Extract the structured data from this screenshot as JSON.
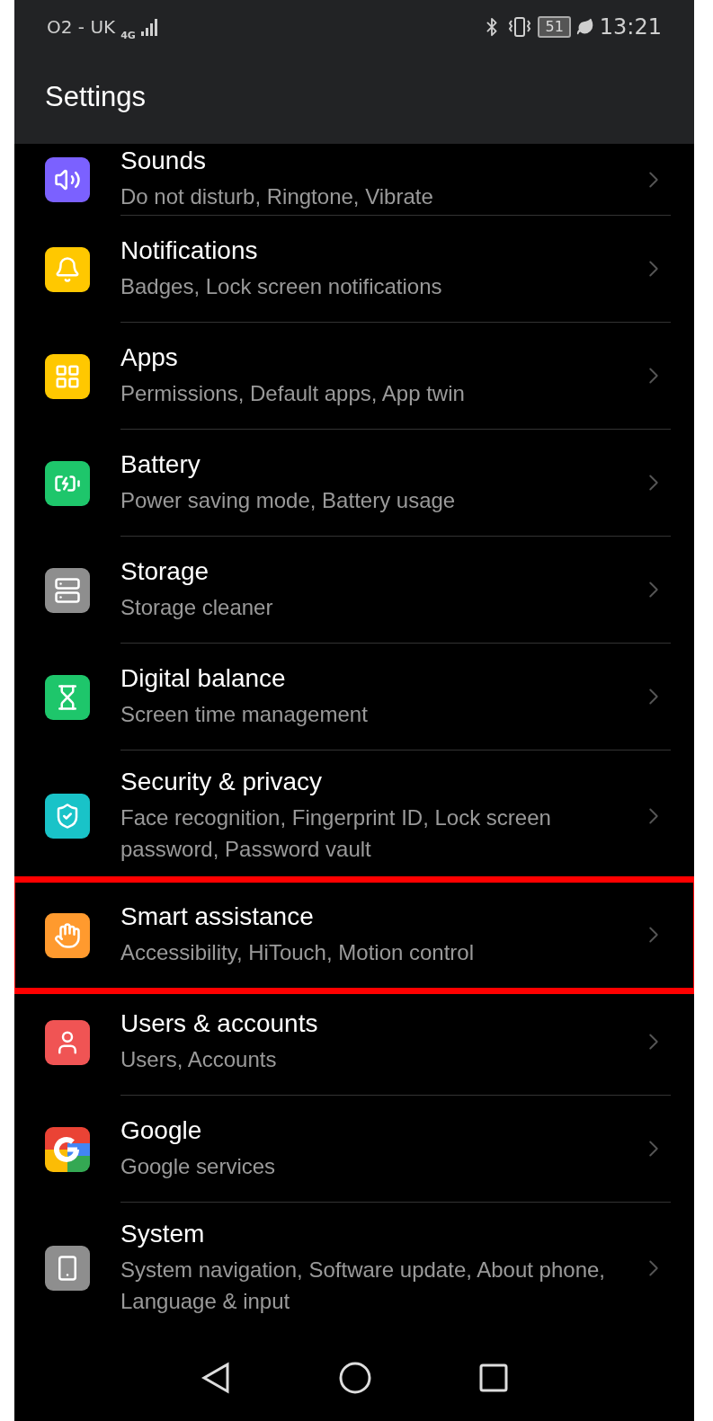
{
  "status_bar": {
    "carrier": "O2 - UK",
    "network": "4G",
    "battery": "51",
    "time": "13:21"
  },
  "title": "Settings",
  "items": [
    {
      "kind": "sound",
      "color": "#7b61ff",
      "title": "Sounds",
      "subtitle": "Do not disturb, Ringtone, Vibrate",
      "highlighted": false
    },
    {
      "kind": "bell",
      "color": "#ffc800",
      "title": "Notifications",
      "subtitle": "Badges, Lock screen notifications",
      "highlighted": false
    },
    {
      "kind": "grid",
      "color": "#ffc800",
      "title": "Apps",
      "subtitle": "Permissions, Default apps, App twin",
      "highlighted": false
    },
    {
      "kind": "battery",
      "color": "#1ec66b",
      "title": "Battery",
      "subtitle": "Power saving mode, Battery usage",
      "highlighted": false
    },
    {
      "kind": "storage",
      "color": "#8e8e8e",
      "title": "Storage",
      "subtitle": "Storage cleaner",
      "highlighted": false
    },
    {
      "kind": "hourglass",
      "color": "#1ec66b",
      "title": "Digital balance",
      "subtitle": "Screen time management",
      "highlighted": false
    },
    {
      "kind": "shield",
      "color": "#19c3c8",
      "title": "Security & privacy",
      "subtitle": "Face recognition, Fingerprint ID, Lock screen password, Password vault",
      "highlighted": false
    },
    {
      "kind": "hand",
      "color": "#ff9a2e",
      "title": "Smart assistance",
      "subtitle": "Accessibility, HiTouch, Motion control",
      "highlighted": true
    },
    {
      "kind": "user",
      "color": "#f05454",
      "title": "Users & accounts",
      "subtitle": "Users, Accounts",
      "highlighted": false
    },
    {
      "kind": "google",
      "color": "#4285f4",
      "title": "Google",
      "subtitle": "Google services",
      "highlighted": false
    },
    {
      "kind": "phone",
      "color": "#8e8e8e",
      "title": "System",
      "subtitle": "System navigation, Software update, About phone, Language & input",
      "highlighted": false
    }
  ]
}
